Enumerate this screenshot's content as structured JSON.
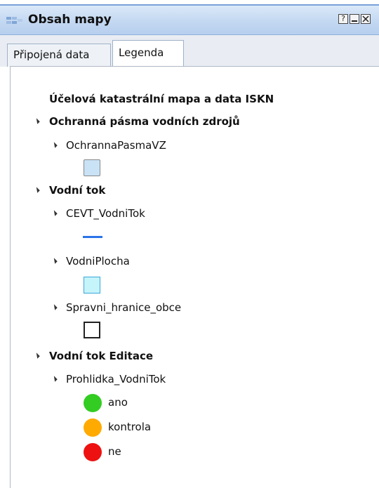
{
  "window": {
    "title": "Obsah mapy",
    "help_button": "?",
    "icon": "map-layers-icon"
  },
  "tabs": [
    {
      "label": "Připojená data",
      "active": false
    },
    {
      "label": "Legenda",
      "active": true
    }
  ],
  "legend": {
    "root_title": "Účelová katastrální mapa a data ISKN",
    "groups": [
      {
        "label": "Ochranná pásma vodních zdrojů",
        "layers": [
          {
            "label": "OchrannaPasmaVZ",
            "symbol": "polygon",
            "fill": "#c9e2f5",
            "stroke": "#888888"
          }
        ]
      },
      {
        "label": "Vodní tok",
        "layers": [
          {
            "label": "CEVT_VodniTok",
            "symbol": "line",
            "stroke": "#2a73e8"
          },
          {
            "label": "VodniPlocha",
            "symbol": "polygon",
            "fill": "#c6f4fb",
            "stroke": "#3aa6d6"
          },
          {
            "label": "Spravni_hranice_obce",
            "symbol": "polygon",
            "fill": "#ffffff",
            "stroke": "#222222"
          }
        ]
      },
      {
        "label": "Vodní tok Editace",
        "layers": [
          {
            "label": "Prohlidka_VodniTok",
            "classes": [
              {
                "label": "ano",
                "color": "#33cc22"
              },
              {
                "label": "kontrola",
                "color": "#ffaa00"
              },
              {
                "label": "ne",
                "color": "#ee1111"
              }
            ]
          }
        ]
      }
    ]
  }
}
